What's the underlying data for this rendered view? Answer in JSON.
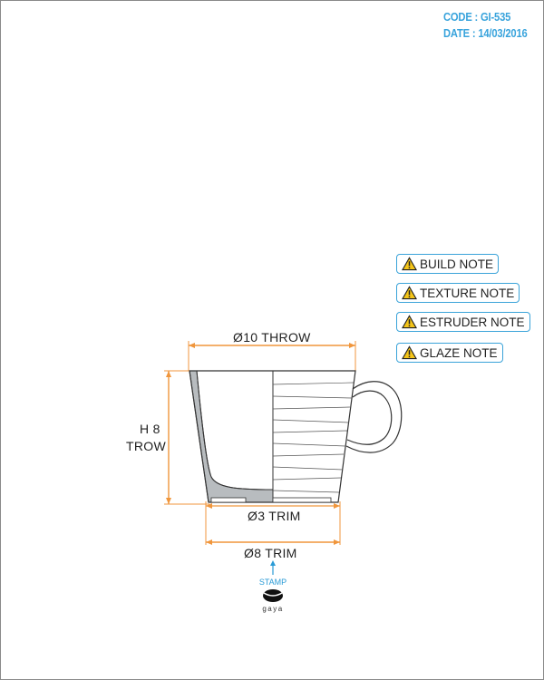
{
  "header": {
    "code": "CODE : GI-535",
    "date": "DATE : 14/03/2016"
  },
  "notes": [
    "BUILD NOTE",
    "TEXTURE NOTE",
    "ESTRUDER NOTE",
    "GLAZE NOTE"
  ],
  "dimensions": {
    "top_diameter": "Ø10 THROW",
    "height_line1": "H 8",
    "height_line2": "TROW",
    "inner_trim": "Ø3 TRIM",
    "base_trim": "Ø8 TRIM"
  },
  "stamp": {
    "label": "STAMP",
    "brand": "gaya"
  },
  "colors": {
    "accent_blue": "#38a3dc",
    "dimension_orange": "#f0963c",
    "section_gray": "#b8bcbf"
  }
}
